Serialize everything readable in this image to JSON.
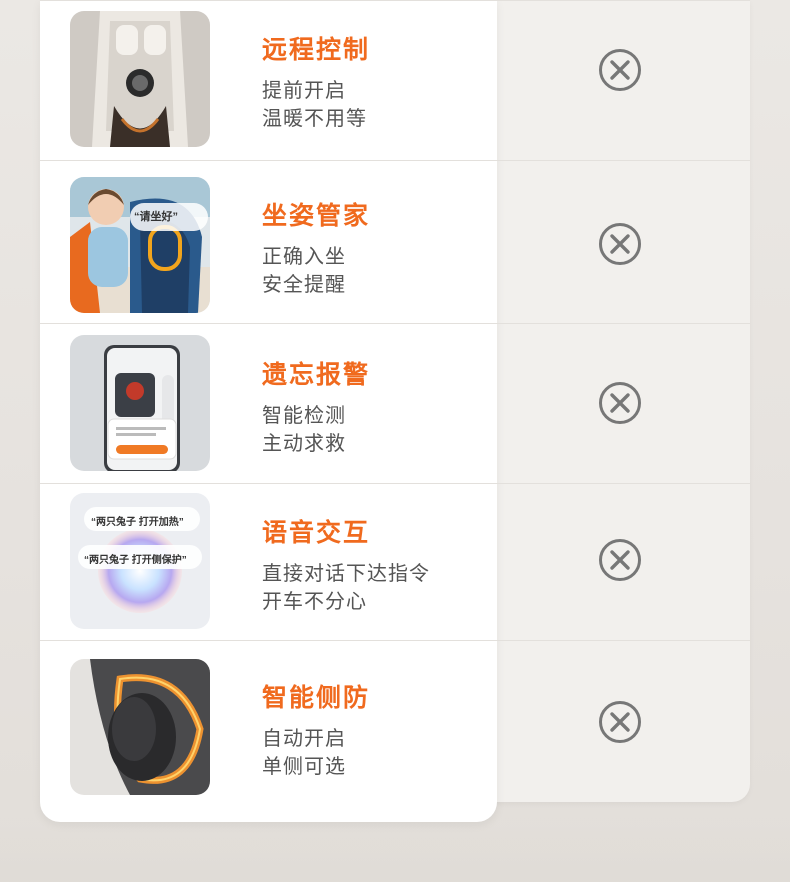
{
  "features": [
    {
      "id": "remote",
      "title": "远程控制",
      "line1": "提前开启",
      "line2": "温暖不用等",
      "image_icon": "car-top-view",
      "status_icon": "x-circle-icon"
    },
    {
      "id": "posture",
      "title": "坐姿管家",
      "line1": "正确入坐",
      "line2": "安全提醒",
      "image_icon": "child-seat-photo",
      "image_bubble": "“请坐好”",
      "status_icon": "x-circle-icon"
    },
    {
      "id": "forget",
      "title": "遗忘报警",
      "line1": "智能检测",
      "line2": "主动求救",
      "image_icon": "phone-alert",
      "status_icon": "x-circle-icon"
    },
    {
      "id": "voice",
      "title": "语音交互",
      "line1": "直接对话下达指令",
      "line2": "开车不分心",
      "image_icon": "voice-orb",
      "image_bubble1": "“两只兔子 打开加热”",
      "image_bubble2": "“两只兔子 打开侧保护”",
      "status_icon": "x-circle-icon"
    },
    {
      "id": "side",
      "title": "智能侧防",
      "line1": "自动开启",
      "line2": "单侧可选",
      "image_icon": "side-protection-light",
      "status_icon": "x-circle-icon"
    }
  ],
  "colors": {
    "accent": "#f06a1e",
    "text": "#555555",
    "icon": "#777777",
    "panel_main": "#ffffff",
    "panel_other": "#f2f0ed"
  }
}
